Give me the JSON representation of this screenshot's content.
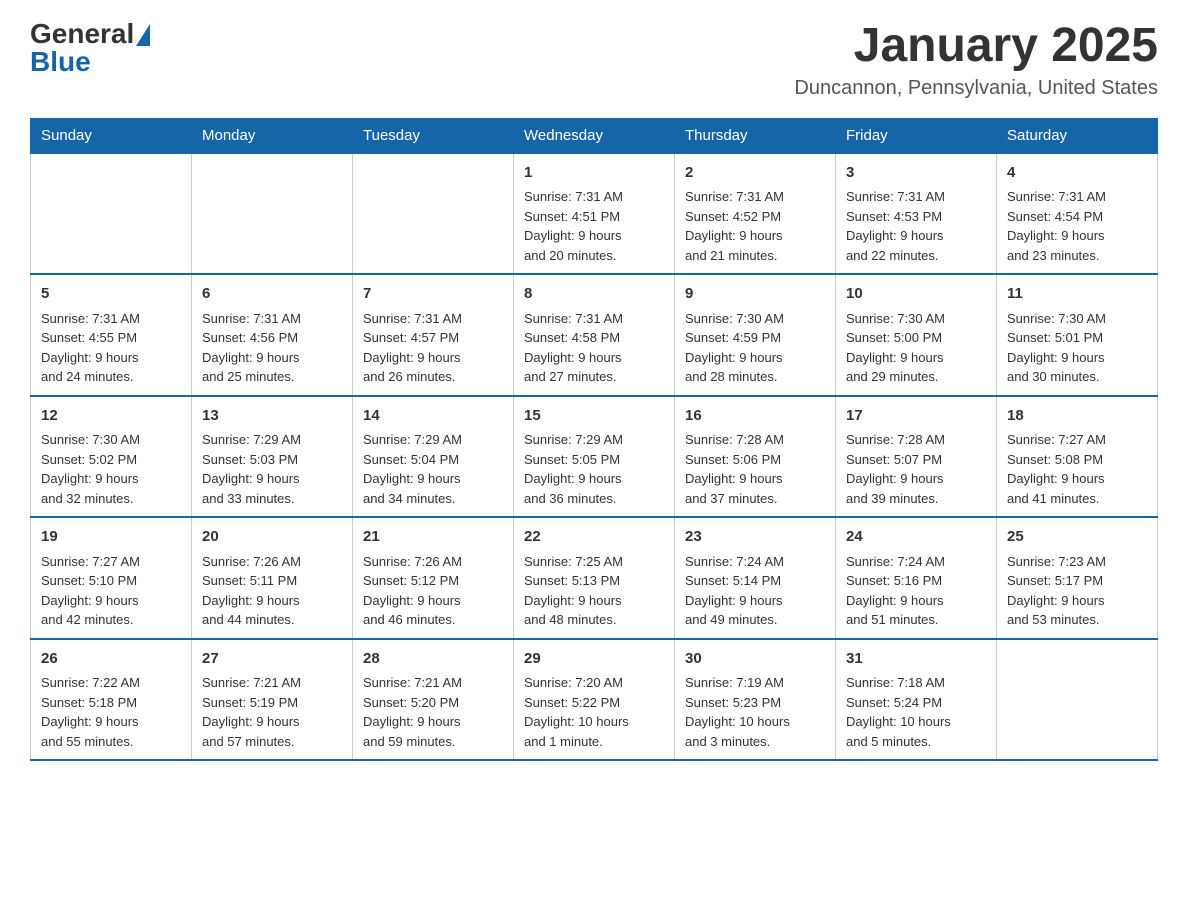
{
  "header": {
    "logo_general": "General",
    "logo_blue": "Blue",
    "month_title": "January 2025",
    "location": "Duncannon, Pennsylvania, United States"
  },
  "days_of_week": [
    "Sunday",
    "Monday",
    "Tuesday",
    "Wednesday",
    "Thursday",
    "Friday",
    "Saturday"
  ],
  "weeks": [
    [
      {
        "day": "",
        "info": ""
      },
      {
        "day": "",
        "info": ""
      },
      {
        "day": "",
        "info": ""
      },
      {
        "day": "1",
        "info": "Sunrise: 7:31 AM\nSunset: 4:51 PM\nDaylight: 9 hours\nand 20 minutes."
      },
      {
        "day": "2",
        "info": "Sunrise: 7:31 AM\nSunset: 4:52 PM\nDaylight: 9 hours\nand 21 minutes."
      },
      {
        "day": "3",
        "info": "Sunrise: 7:31 AM\nSunset: 4:53 PM\nDaylight: 9 hours\nand 22 minutes."
      },
      {
        "day": "4",
        "info": "Sunrise: 7:31 AM\nSunset: 4:54 PM\nDaylight: 9 hours\nand 23 minutes."
      }
    ],
    [
      {
        "day": "5",
        "info": "Sunrise: 7:31 AM\nSunset: 4:55 PM\nDaylight: 9 hours\nand 24 minutes."
      },
      {
        "day": "6",
        "info": "Sunrise: 7:31 AM\nSunset: 4:56 PM\nDaylight: 9 hours\nand 25 minutes."
      },
      {
        "day": "7",
        "info": "Sunrise: 7:31 AM\nSunset: 4:57 PM\nDaylight: 9 hours\nand 26 minutes."
      },
      {
        "day": "8",
        "info": "Sunrise: 7:31 AM\nSunset: 4:58 PM\nDaylight: 9 hours\nand 27 minutes."
      },
      {
        "day": "9",
        "info": "Sunrise: 7:30 AM\nSunset: 4:59 PM\nDaylight: 9 hours\nand 28 minutes."
      },
      {
        "day": "10",
        "info": "Sunrise: 7:30 AM\nSunset: 5:00 PM\nDaylight: 9 hours\nand 29 minutes."
      },
      {
        "day": "11",
        "info": "Sunrise: 7:30 AM\nSunset: 5:01 PM\nDaylight: 9 hours\nand 30 minutes."
      }
    ],
    [
      {
        "day": "12",
        "info": "Sunrise: 7:30 AM\nSunset: 5:02 PM\nDaylight: 9 hours\nand 32 minutes."
      },
      {
        "day": "13",
        "info": "Sunrise: 7:29 AM\nSunset: 5:03 PM\nDaylight: 9 hours\nand 33 minutes."
      },
      {
        "day": "14",
        "info": "Sunrise: 7:29 AM\nSunset: 5:04 PM\nDaylight: 9 hours\nand 34 minutes."
      },
      {
        "day": "15",
        "info": "Sunrise: 7:29 AM\nSunset: 5:05 PM\nDaylight: 9 hours\nand 36 minutes."
      },
      {
        "day": "16",
        "info": "Sunrise: 7:28 AM\nSunset: 5:06 PM\nDaylight: 9 hours\nand 37 minutes."
      },
      {
        "day": "17",
        "info": "Sunrise: 7:28 AM\nSunset: 5:07 PM\nDaylight: 9 hours\nand 39 minutes."
      },
      {
        "day": "18",
        "info": "Sunrise: 7:27 AM\nSunset: 5:08 PM\nDaylight: 9 hours\nand 41 minutes."
      }
    ],
    [
      {
        "day": "19",
        "info": "Sunrise: 7:27 AM\nSunset: 5:10 PM\nDaylight: 9 hours\nand 42 minutes."
      },
      {
        "day": "20",
        "info": "Sunrise: 7:26 AM\nSunset: 5:11 PM\nDaylight: 9 hours\nand 44 minutes."
      },
      {
        "day": "21",
        "info": "Sunrise: 7:26 AM\nSunset: 5:12 PM\nDaylight: 9 hours\nand 46 minutes."
      },
      {
        "day": "22",
        "info": "Sunrise: 7:25 AM\nSunset: 5:13 PM\nDaylight: 9 hours\nand 48 minutes."
      },
      {
        "day": "23",
        "info": "Sunrise: 7:24 AM\nSunset: 5:14 PM\nDaylight: 9 hours\nand 49 minutes."
      },
      {
        "day": "24",
        "info": "Sunrise: 7:24 AM\nSunset: 5:16 PM\nDaylight: 9 hours\nand 51 minutes."
      },
      {
        "day": "25",
        "info": "Sunrise: 7:23 AM\nSunset: 5:17 PM\nDaylight: 9 hours\nand 53 minutes."
      }
    ],
    [
      {
        "day": "26",
        "info": "Sunrise: 7:22 AM\nSunset: 5:18 PM\nDaylight: 9 hours\nand 55 minutes."
      },
      {
        "day": "27",
        "info": "Sunrise: 7:21 AM\nSunset: 5:19 PM\nDaylight: 9 hours\nand 57 minutes."
      },
      {
        "day": "28",
        "info": "Sunrise: 7:21 AM\nSunset: 5:20 PM\nDaylight: 9 hours\nand 59 minutes."
      },
      {
        "day": "29",
        "info": "Sunrise: 7:20 AM\nSunset: 5:22 PM\nDaylight: 10 hours\nand 1 minute."
      },
      {
        "day": "30",
        "info": "Sunrise: 7:19 AM\nSunset: 5:23 PM\nDaylight: 10 hours\nand 3 minutes."
      },
      {
        "day": "31",
        "info": "Sunrise: 7:18 AM\nSunset: 5:24 PM\nDaylight: 10 hours\nand 5 minutes."
      },
      {
        "day": "",
        "info": ""
      }
    ]
  ]
}
